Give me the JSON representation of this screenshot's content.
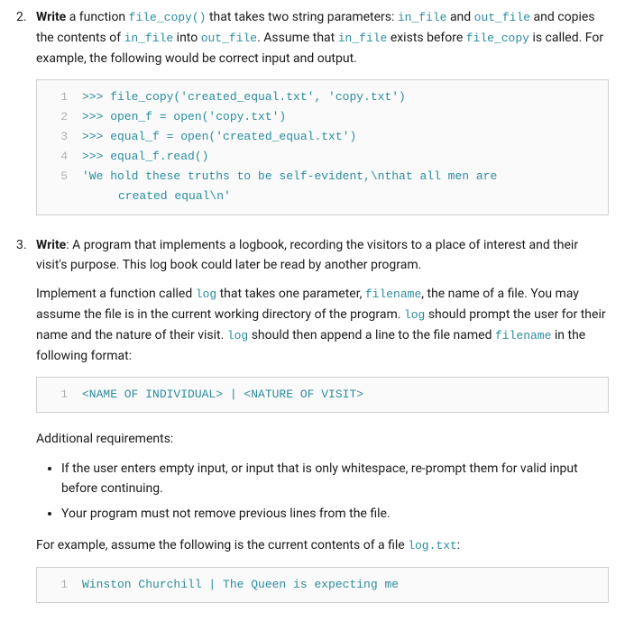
{
  "q2": {
    "lead_bold": "Write",
    "lead_rest_1": " a function ",
    "fn": "file_copy()",
    "lead_rest_2": " that takes two string parameters: ",
    "p_in": "in_file",
    "lead_rest_3": " and ",
    "p_out": "out_file",
    "lead_rest_4": " and copies the contents of ",
    "p_in2": "in_file",
    "lead_rest_5": " into ",
    "p_out2": "out_file",
    "lead_rest_6": ". Assume that ",
    "p_in3": "in_file",
    "lead_rest_7": " exists before ",
    "fn2": "file_copy",
    "lead_rest_8": " is called. For example, the following would be correct input and output.",
    "code": {
      "l1": ">>> file_copy('created_equal.txt', 'copy.txt')",
      "l2": ">>> open_f = open('copy.txt')",
      "l3": ">>> equal_f = open('created_equal.txt')",
      "l4": ">>> equal_f.read()",
      "l5": "'We hold these truths to be self-evident,\\nthat all men are",
      "l5b": "created equal\\n'"
    }
  },
  "q3": {
    "lead_bold": "Write",
    "lead_rest_1": ": A program that implements a logbook, recording the visitors to a place of interest and their visit's purpose. This log book could later be read by another program.",
    "p2_a": "Implement a function called ",
    "fn": "log",
    "p2_b": " that takes one parameter, ",
    "param": "filename",
    "p2_c": ", the name of a file. You may assume the file is in the current working directory of the program. ",
    "fn2": "log",
    "p2_d": " should prompt the user for their name and the nature of their visit. ",
    "fn3": "log",
    "p2_e": " should then append a line to the file named ",
    "param2": "filename",
    "p2_f": " in the following format:",
    "fmt_code": "<NAME OF INDIVIDUAL> | <NATURE OF VISIT>",
    "additional": "Additional requirements:",
    "req1": "If the user enters empty input, or input that is only whitespace, re-prompt them for valid input before continuing.",
    "req2": "Your program must not remove previous lines from the file.",
    "example_a": "For example, assume the following is the current contents of a file ",
    "example_file": "log.txt",
    "example_b": ":",
    "log_code": "Winston Churchill | The Queen is expecting me"
  },
  "nums": {
    "n1": "1",
    "n2": "2",
    "n3": "3",
    "n4": "4",
    "n5": "5"
  }
}
